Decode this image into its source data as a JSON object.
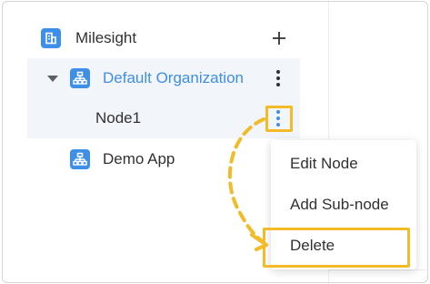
{
  "tree": {
    "root": {
      "label": "Milesight",
      "icon": "building-icon",
      "add_icon": "plus-icon"
    },
    "organization": {
      "label": "Default Organization",
      "icon": "org-chart-icon",
      "expanded": true,
      "label_color": "#3d8fe8"
    },
    "node": {
      "label": "Node1",
      "more_icon": "kebab-icon"
    },
    "app": {
      "label": "Demo App",
      "icon": "org-chart-icon"
    }
  },
  "context_menu": {
    "items": [
      {
        "label": "Edit Node"
      },
      {
        "label": "Add Sub-node"
      },
      {
        "label": "Delete"
      }
    ]
  },
  "colors": {
    "accent": "#3d8fe8",
    "highlight": "#f3bb27",
    "selected_row_bg": "#f2f5fa"
  }
}
